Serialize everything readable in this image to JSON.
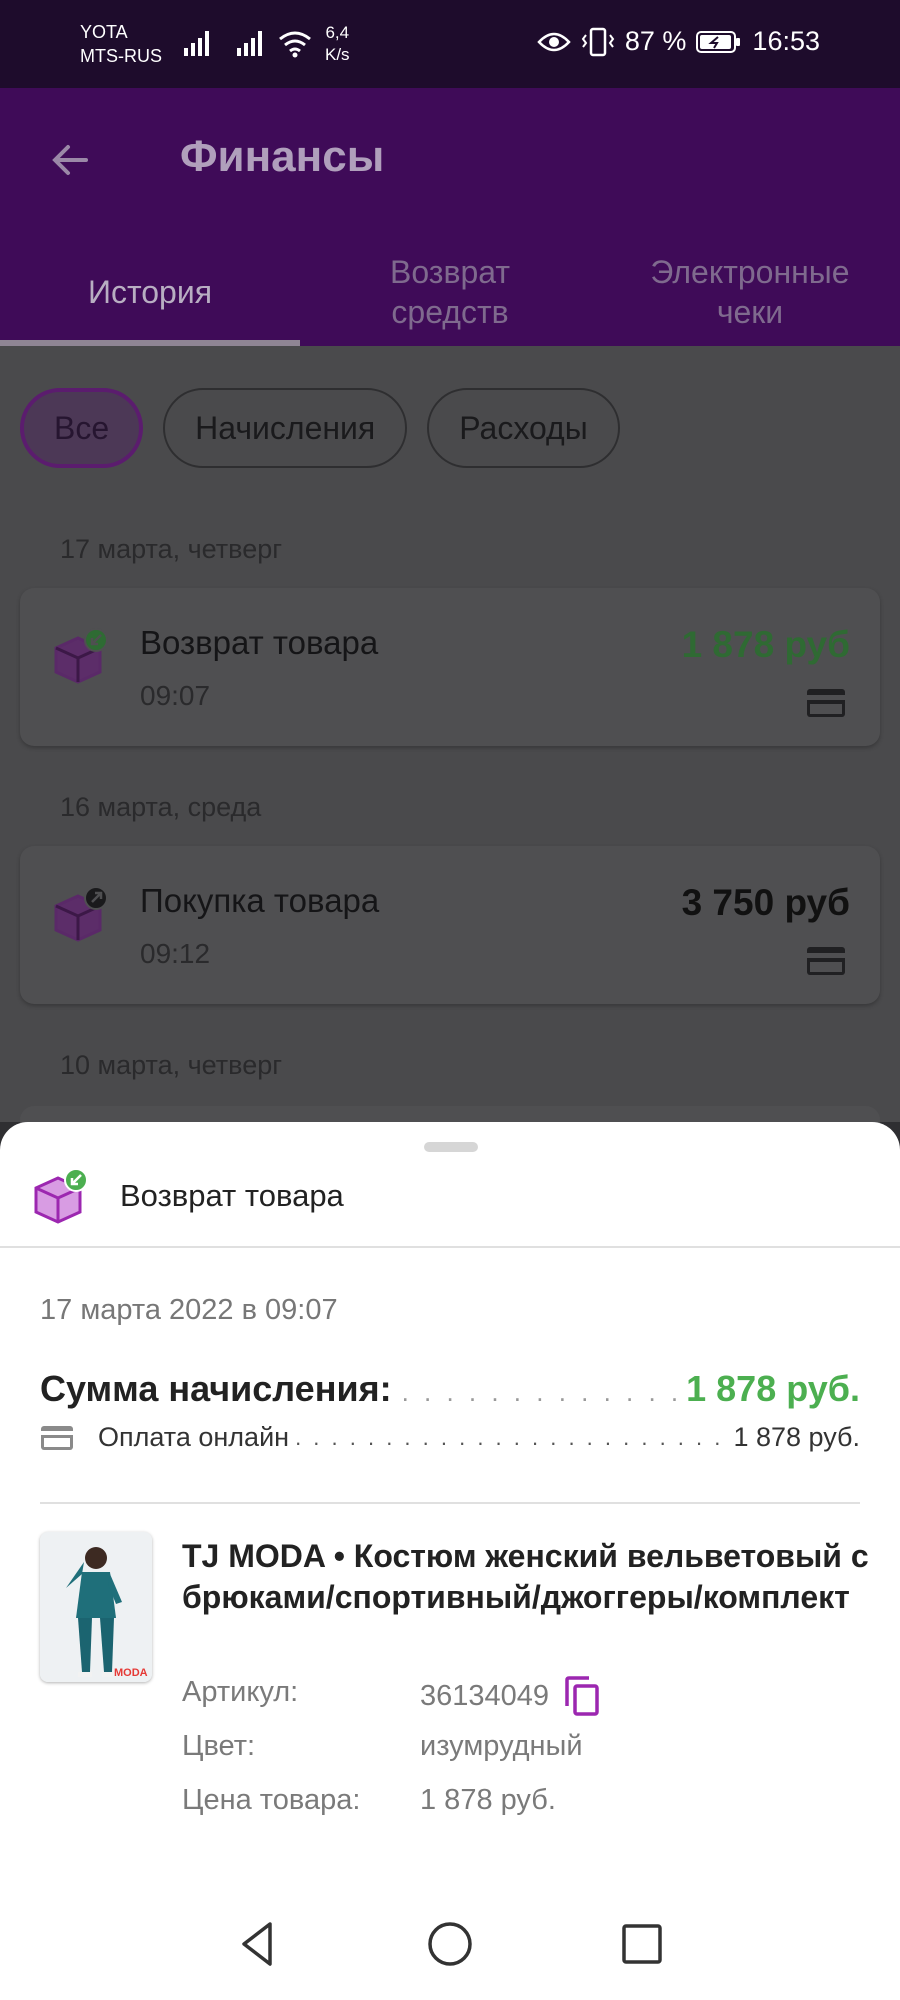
{
  "status_bar": {
    "carrier1": "YOTA",
    "carrier2": "MTS-RUS",
    "speed_value": "6,4",
    "speed_unit": "K/s",
    "battery": "87 %",
    "time": "16:53"
  },
  "app_bar": {
    "title": "Финансы"
  },
  "tabs": [
    {
      "label": "История"
    },
    {
      "label": "Возврат средств"
    },
    {
      "label": "Электронные чеки"
    }
  ],
  "filters": [
    {
      "label": "Все"
    },
    {
      "label": "Начисления"
    },
    {
      "label": "Расходы"
    }
  ],
  "groups": [
    {
      "date": "17 марта, четверг",
      "title": "Возврат товара",
      "time": "09:07",
      "amount": "1 878 руб"
    },
    {
      "date": "16 марта, среда",
      "title": "Покупка товара",
      "time": "09:12",
      "amount": "3 750 руб"
    },
    {
      "date": "10 марта, четверг"
    }
  ],
  "sheet": {
    "title": "Возврат товара",
    "date": "17 марта 2022 в 09:07",
    "sum_label": "Сумма начисления:",
    "sum_value": "1 878 руб.",
    "pay_label": "Оплата онлайн",
    "pay_value": "1 878 руб.",
    "product_name": "TJ MODA • Костюм женский вельветовый с брюками/спортивный/джоггеры/комплект",
    "thumb_brand": "MODA",
    "article_label": "Артикул:",
    "article_value": "36134049",
    "color_label": "Цвет:",
    "color_value": "изумрудный",
    "price_label": "Цена товара:",
    "price_value": "1 878 руб."
  },
  "colors": {
    "app_bar": "#3f0b58",
    "accent_purple": "#9c27b0",
    "credit_green": "#4caf50"
  },
  "icons": [
    "back-arrow-icon",
    "box-return-icon",
    "box-purchase-icon",
    "card-icon",
    "copy-icon",
    "nav-back-icon",
    "nav-home-icon",
    "nav-recents-icon"
  ]
}
